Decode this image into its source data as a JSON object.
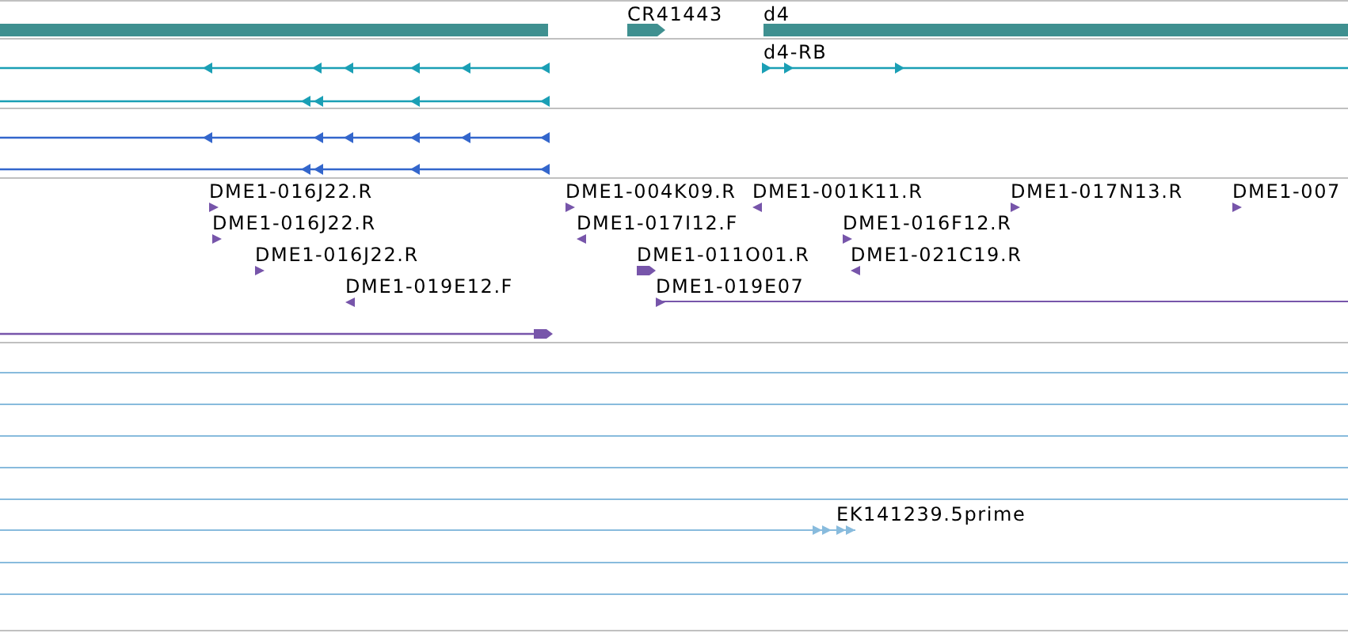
{
  "genes": [
    {
      "label": "CR41443",
      "reverse": false
    },
    {
      "label": "d4",
      "reverse": false
    }
  ],
  "transcripts": [
    {
      "label": "d4-RB",
      "reverse": false
    }
  ],
  "reads": [
    {
      "label": "DME1-016J22.R",
      "reverse": false
    },
    {
      "label": "DME1-016J22.R",
      "reverse": false
    },
    {
      "label": "DME1-016J22.R",
      "reverse": false
    },
    {
      "label": "DME1-019E12.F",
      "reverse": true
    },
    {
      "label": "DME1-004K09.R",
      "reverse": false
    },
    {
      "label": "DME1-017I12.F",
      "reverse": true
    },
    {
      "label": "DME1-011O01.R",
      "reverse": false
    },
    {
      "label": "DME1-019E07",
      "reverse": false
    },
    {
      "label": "DME1-001K11.R",
      "reverse": true
    },
    {
      "label": "DME1-016F12.R",
      "reverse": false
    },
    {
      "label": "DME1-021C19.R",
      "reverse": true
    },
    {
      "label": "DME1-017N13.R",
      "reverse": false
    },
    {
      "label": "DME1-007",
      "reverse": false
    }
  ],
  "ests": [
    {
      "label": "EK141239.5prime",
      "reverse": false
    }
  ]
}
